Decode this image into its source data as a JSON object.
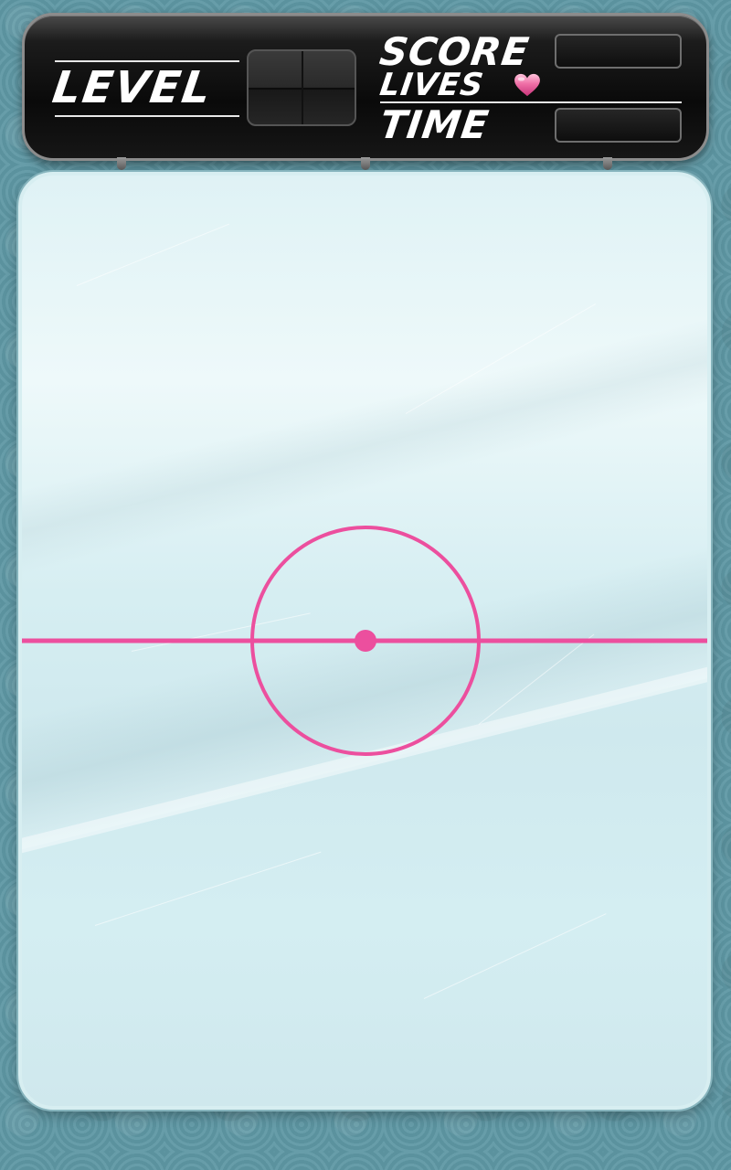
{
  "hud": {
    "level_label": "LEVEL",
    "level_digits": [
      "",
      ""
    ],
    "score_label": "SCORE",
    "score_value": "",
    "lives_label": "LIVES",
    "lives_icon": "heart-icon",
    "lives_value": "",
    "time_label": "TIME",
    "time_value": ""
  },
  "rink": {
    "line_color": "#ec4f9e",
    "ice_color": "#d8eff3"
  },
  "colors": {
    "background": "#5f98a4",
    "hud_bg": "#111111",
    "hud_border": "#8c8c8c",
    "heart": "#ef6fa6"
  }
}
